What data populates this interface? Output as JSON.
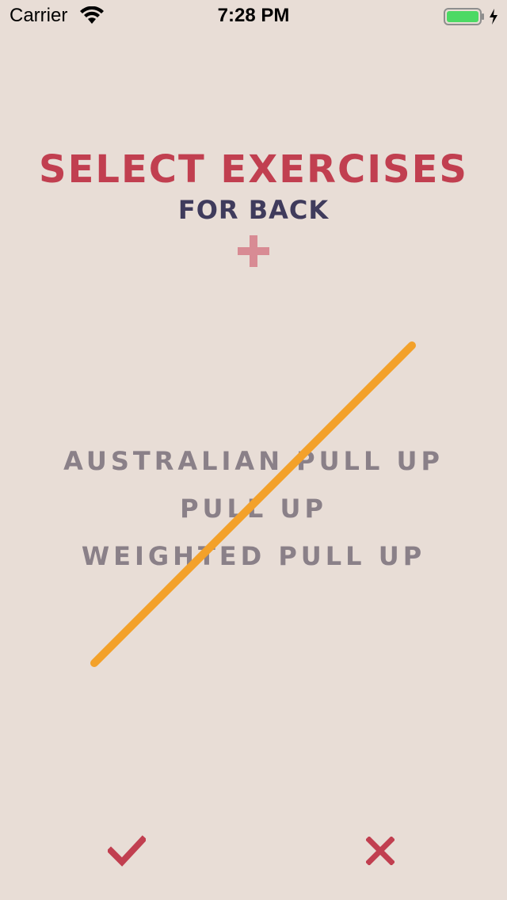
{
  "status_bar": {
    "carrier": "Carrier",
    "time": "7:28 PM",
    "wifi_icon": "wifi-icon",
    "battery_icon": "battery-charging-icon"
  },
  "header": {
    "title": "SELECT EXERCISES",
    "subtitle": "FOR BACK",
    "add_icon": "plus-icon"
  },
  "exercises": [
    "AUSTRALIAN PULL UP",
    "PULL UP",
    "WEIGHTED PULL UP"
  ],
  "actions": {
    "confirm_icon": "checkmark-icon",
    "cancel_icon": "close-icon"
  },
  "colors": {
    "background": "#e8ddd6",
    "title": "#c13f50",
    "subtitle": "#3f3b5c",
    "plus": "#d88b94",
    "exercise_text": "#8a8088",
    "slash_line": "#f3a12a",
    "confirm": "#c13f50",
    "cancel": "#c13f50",
    "battery": "#4cd964"
  }
}
